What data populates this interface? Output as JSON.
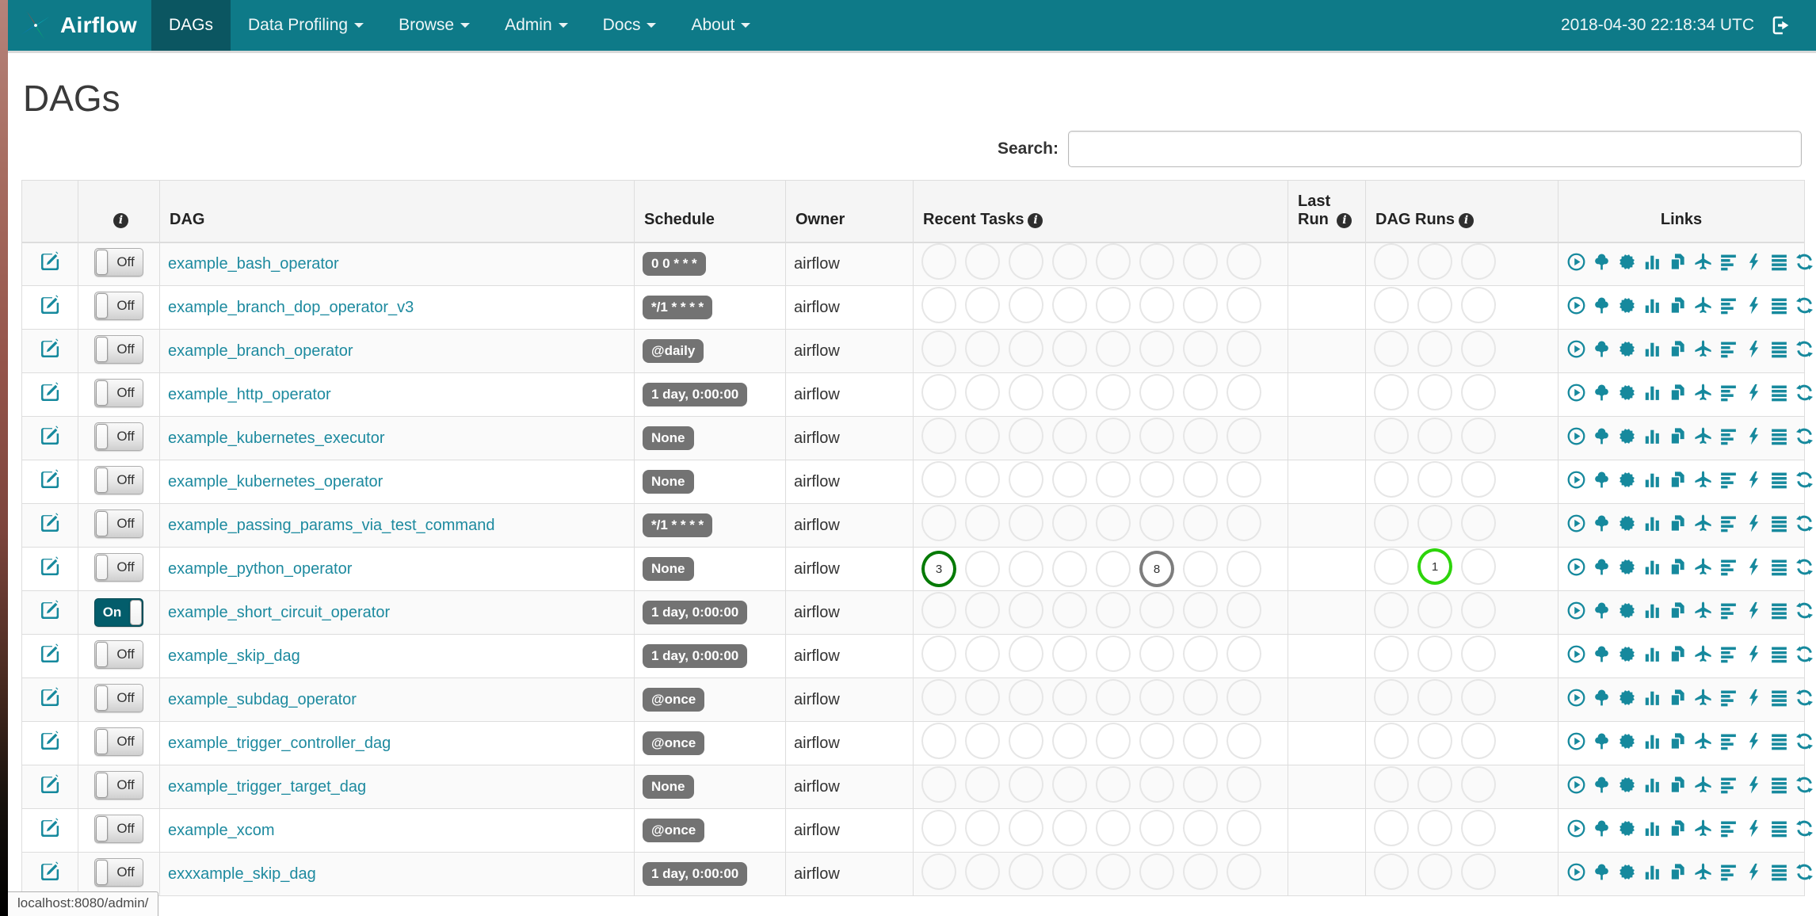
{
  "navbar": {
    "brand": "Airflow",
    "items": [
      {
        "label": "DAGs",
        "active": true,
        "dropdown": false
      },
      {
        "label": "Data Profiling",
        "active": false,
        "dropdown": true
      },
      {
        "label": "Browse",
        "active": false,
        "dropdown": true
      },
      {
        "label": "Admin",
        "active": false,
        "dropdown": true
      },
      {
        "label": "Docs",
        "active": false,
        "dropdown": true
      },
      {
        "label": "About",
        "active": false,
        "dropdown": true
      }
    ],
    "clock": "2018-04-30 22:18:34 UTC",
    "logout_icon": "sign-out-icon"
  },
  "page": {
    "title": "DAGs"
  },
  "search": {
    "label": "Search:",
    "value": ""
  },
  "table": {
    "headers": [
      {
        "label": "",
        "info": false
      },
      {
        "label": "",
        "info": true
      },
      {
        "label": "DAG",
        "info": false
      },
      {
        "label": "Schedule",
        "info": false
      },
      {
        "label": "Owner",
        "info": false
      },
      {
        "label": "Recent Tasks",
        "info": true
      },
      {
        "label": "Last Run",
        "info": true
      },
      {
        "label": "DAG Runs",
        "info": true
      },
      {
        "label": "Links",
        "info": false
      }
    ],
    "recent_task_slots": 8,
    "dag_run_slots": 3
  },
  "state_colors": {
    "success": "#067a06",
    "queued": "#7d7d7d",
    "running": "#2dd40b",
    "none": "#e6e6e6"
  },
  "links": [
    {
      "name": "trigger-dag",
      "label": "Trigger Dag",
      "icon": "play-circle"
    },
    {
      "name": "tree-view",
      "label": "Tree View",
      "icon": "tree"
    },
    {
      "name": "graph-view",
      "label": "Graph View",
      "icon": "sunburst"
    },
    {
      "name": "task-duration",
      "label": "Task Duration",
      "icon": "bar-chart"
    },
    {
      "name": "task-tries",
      "label": "Task Tries",
      "icon": "duplicate"
    },
    {
      "name": "landing-times",
      "label": "Landing Times",
      "icon": "plane"
    },
    {
      "name": "gantt-view",
      "label": "Gantt View",
      "icon": "align-left"
    },
    {
      "name": "code-view",
      "label": "Code View",
      "icon": "flash"
    },
    {
      "name": "logs",
      "label": "Logs",
      "icon": "align-justify"
    },
    {
      "name": "refresh",
      "label": "Refresh",
      "icon": "refresh"
    }
  ],
  "rows": [
    {
      "name": "example_bash_operator",
      "toggle_label": "Off",
      "enabled": false,
      "schedule": "0 0 * * *",
      "owner": "airflow",
      "recent_tasks": [],
      "dag_runs": []
    },
    {
      "name": "example_branch_dop_operator_v3",
      "toggle_label": "Off",
      "enabled": false,
      "schedule": "*/1 * * * *",
      "owner": "airflow",
      "recent_tasks": [],
      "dag_runs": []
    },
    {
      "name": "example_branch_operator",
      "toggle_label": "Off",
      "enabled": false,
      "schedule": "@daily",
      "owner": "airflow",
      "recent_tasks": [],
      "dag_runs": []
    },
    {
      "name": "example_http_operator",
      "toggle_label": "Off",
      "enabled": false,
      "schedule": "1 day, 0:00:00",
      "owner": "airflow",
      "recent_tasks": [],
      "dag_runs": []
    },
    {
      "name": "example_kubernetes_executor",
      "toggle_label": "Off",
      "enabled": false,
      "schedule": "None",
      "owner": "airflow",
      "recent_tasks": [],
      "dag_runs": []
    },
    {
      "name": "example_kubernetes_operator",
      "toggle_label": "Off",
      "enabled": false,
      "schedule": "None",
      "owner": "airflow",
      "recent_tasks": [],
      "dag_runs": []
    },
    {
      "name": "example_passing_params_via_test_command",
      "toggle_label": "Off",
      "enabled": false,
      "schedule": "*/1 * * * *",
      "owner": "airflow",
      "recent_tasks": [],
      "dag_runs": []
    },
    {
      "name": "example_python_operator",
      "toggle_label": "Off",
      "enabled": false,
      "schedule": "None",
      "owner": "airflow",
      "recent_tasks": [
        {
          "pos": 0,
          "count": "3",
          "state": "success"
        },
        {
          "pos": 5,
          "count": "8",
          "state": "queued"
        }
      ],
      "dag_runs": [
        {
          "pos": 1,
          "count": "1",
          "state": "running"
        }
      ]
    },
    {
      "name": "example_short_circuit_operator",
      "toggle_label": "On",
      "enabled": true,
      "schedule": "1 day, 0:00:00",
      "owner": "airflow",
      "recent_tasks": [],
      "dag_runs": []
    },
    {
      "name": "example_skip_dag",
      "toggle_label": "Off",
      "enabled": false,
      "schedule": "1 day, 0:00:00",
      "owner": "airflow",
      "recent_tasks": [],
      "dag_runs": []
    },
    {
      "name": "example_subdag_operator",
      "toggle_label": "Off",
      "enabled": false,
      "schedule": "@once",
      "owner": "airflow",
      "recent_tasks": [],
      "dag_runs": []
    },
    {
      "name": "example_trigger_controller_dag",
      "toggle_label": "Off",
      "enabled": false,
      "schedule": "@once",
      "owner": "airflow",
      "recent_tasks": [],
      "dag_runs": []
    },
    {
      "name": "example_trigger_target_dag",
      "toggle_label": "Off",
      "enabled": false,
      "schedule": "None",
      "owner": "airflow",
      "recent_tasks": [],
      "dag_runs": []
    },
    {
      "name": "example_xcom",
      "toggle_label": "Off",
      "enabled": false,
      "schedule": "@once",
      "owner": "airflow",
      "recent_tasks": [],
      "dag_runs": []
    },
    {
      "name": "exxxample_skip_dag",
      "toggle_label": "Off",
      "enabled": false,
      "schedule": "1 day, 0:00:00",
      "owner": "airflow",
      "recent_tasks": [],
      "dag_runs": []
    }
  ],
  "status_bar": {
    "text": "localhost:8080/admin/"
  }
}
